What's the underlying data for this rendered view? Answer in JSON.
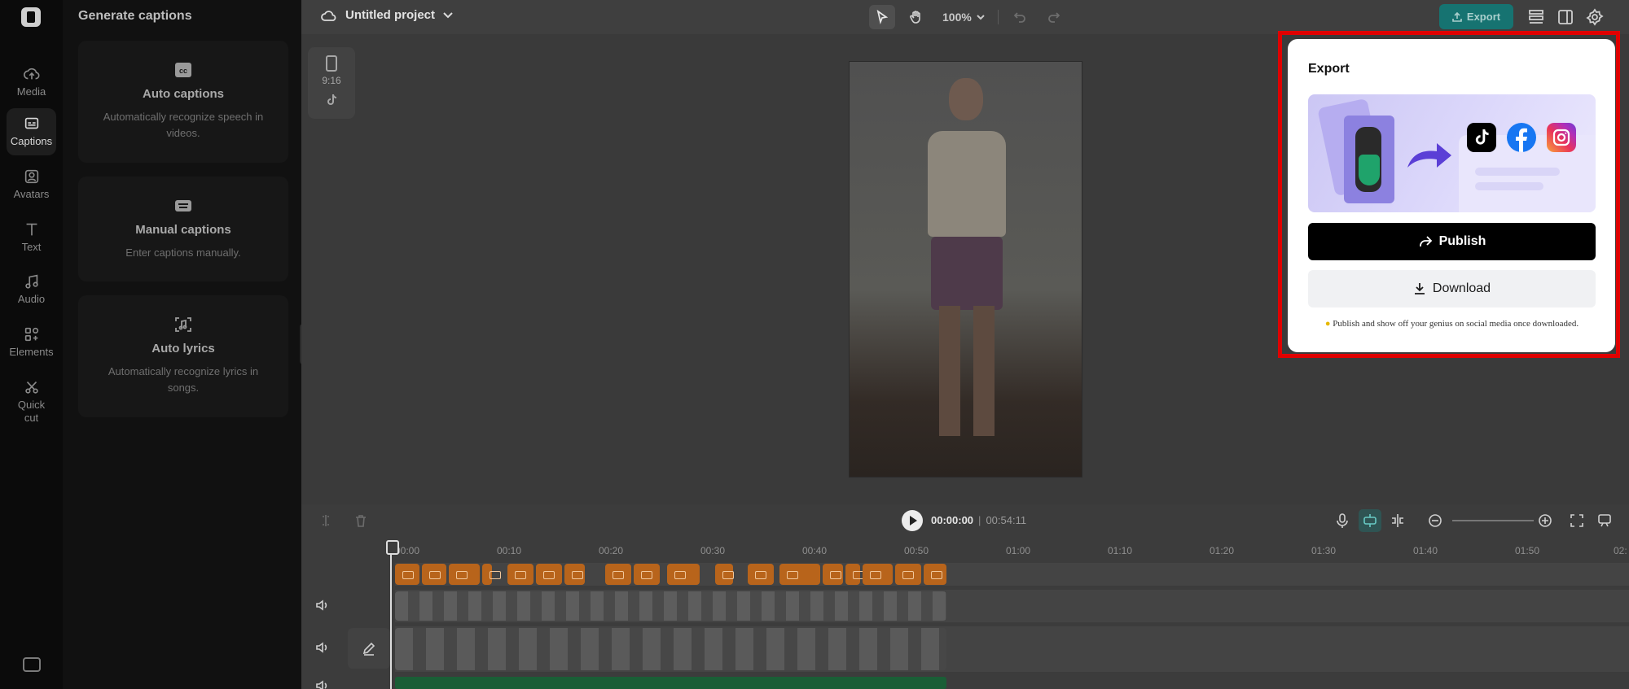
{
  "rail": {
    "items": [
      {
        "label": "Media",
        "icon": "cloud-upload-icon"
      },
      {
        "label": "Captions",
        "icon": "captions-icon"
      },
      {
        "label": "Avatars",
        "icon": "avatar-icon"
      },
      {
        "label": "Text",
        "icon": "text-icon"
      },
      {
        "label": "Audio",
        "icon": "music-icon"
      },
      {
        "label": "Elements",
        "icon": "elements-icon"
      },
      {
        "label": "Quick cut",
        "icon": "scissors-icon"
      }
    ],
    "active": "Captions"
  },
  "panel": {
    "title": "Generate captions",
    "cards": [
      {
        "title": "Auto captions",
        "desc": "Automatically recognize speech in videos."
      },
      {
        "title": "Manual captions",
        "desc": "Enter captions manually."
      },
      {
        "title": "Auto lyrics",
        "desc": "Automatically recognize lyrics in songs."
      }
    ]
  },
  "topbar": {
    "project_name": "Untitled project",
    "zoom": "100%",
    "export_label": "Export"
  },
  "canvas": {
    "ratio_label": "9:16"
  },
  "timeline": {
    "current_time": "00:00:00",
    "total_time": "00:54:11",
    "ruler": [
      "00:00",
      "00:10",
      "00:20",
      "00:30",
      "00:40",
      "00:50",
      "01:00",
      "01:10",
      "01:20",
      "01:30",
      "01:40",
      "01:50",
      "02:"
    ]
  },
  "export_popup": {
    "title": "Export",
    "publish_label": "Publish",
    "download_label": "Download",
    "note": "Publish and show off your genius on social media once downloaded.",
    "note_icon": "lightbulb-icon"
  },
  "colors": {
    "accent": "#167371",
    "highlight": "#e00000",
    "caption_clip": "#b8641b"
  }
}
